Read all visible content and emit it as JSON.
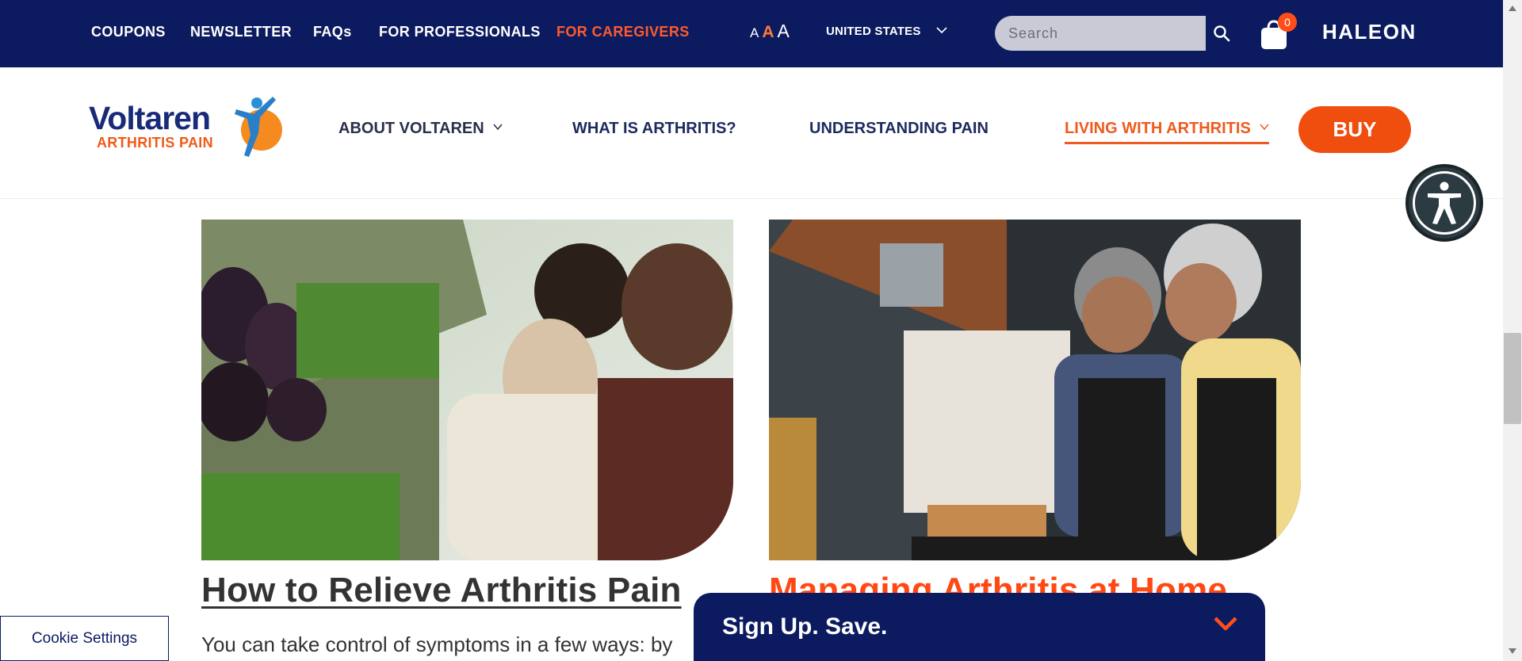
{
  "utility_nav": {
    "items": [
      {
        "label": "COUPONS"
      },
      {
        "label": "NEWSLETTER"
      },
      {
        "label": "FAQs"
      },
      {
        "label": "FOR PROFESSIONALS"
      },
      {
        "label": "FOR CAREGIVERS",
        "active": true
      }
    ],
    "font_size": {
      "small": "A",
      "medium": "A",
      "large": "A"
    },
    "country": "UNITED STATES",
    "search": {
      "placeholder": "Search",
      "value": ""
    },
    "cart_count": "0",
    "brand": "HALEON"
  },
  "main_nav": {
    "logo": {
      "word": "Voltaren",
      "sub": "ARTHRITIS PAIN"
    },
    "items": [
      {
        "label": "ABOUT VOLTAREN",
        "has_dropdown": true
      },
      {
        "label": "WHAT IS ARTHRITIS?",
        "has_dropdown": false
      },
      {
        "label": "UNDERSTANDING PAIN",
        "has_dropdown": false
      },
      {
        "label": "LIVING WITH ARTHRITIS",
        "has_dropdown": true,
        "current": true
      }
    ],
    "buy_label": "BUY"
  },
  "cards": [
    {
      "title": "How to Relieve Arthritis Pain",
      "description": "You can take control of symptoms in a few ways: by"
    },
    {
      "title": "Managing Arthritis at Home"
    }
  ],
  "signup": {
    "label": "Sign Up. Save."
  },
  "cookie_settings": "Cookie Settings",
  "colors": {
    "navy": "#0c1b5f",
    "accent_orange": "#ef4e0f",
    "title_orange": "#ff4814",
    "text_dark": "#333333"
  },
  "icons": [
    "search-icon",
    "cart-icon",
    "chevron-down-icon",
    "accessibility-icon"
  ]
}
